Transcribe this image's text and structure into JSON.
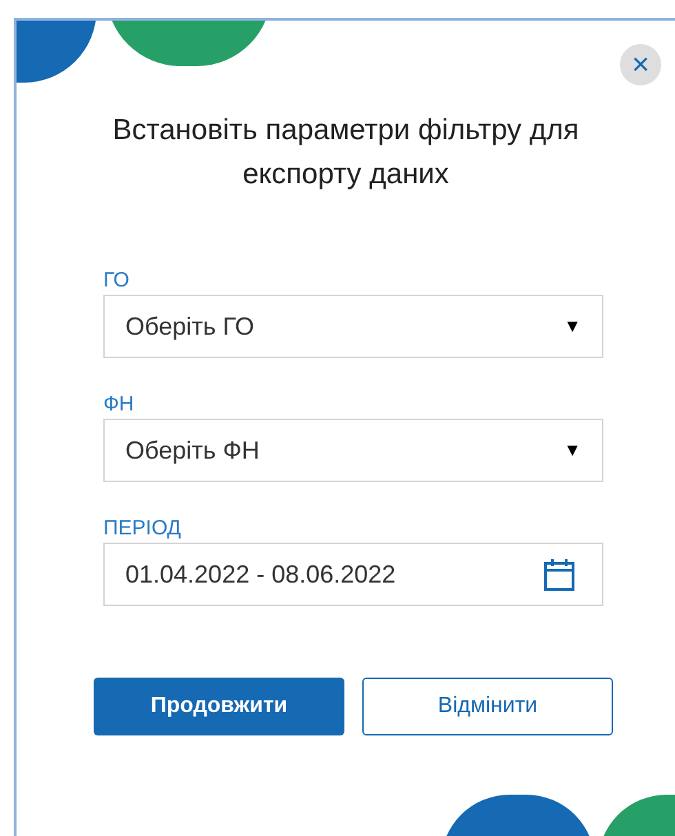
{
  "dialog": {
    "title": "Встановіть параметри фільтру для експорту даних",
    "close": "×"
  },
  "fields": [
    {
      "kind": "select",
      "label": "ГО",
      "value": "Оберіть ГО",
      "caret": "▼"
    },
    {
      "kind": "select",
      "label": "ФН",
      "value": "Оберіть ФН",
      "caret": "▼"
    },
    {
      "kind": "date",
      "label": "ПЕРІОД",
      "value": "01.04.2022 - 08.06.2022"
    }
  ],
  "buttons": [
    {
      "kind": "primary",
      "label": "Продовжити"
    },
    {
      "kind": "secondary",
      "label": "Відмінити"
    }
  ]
}
